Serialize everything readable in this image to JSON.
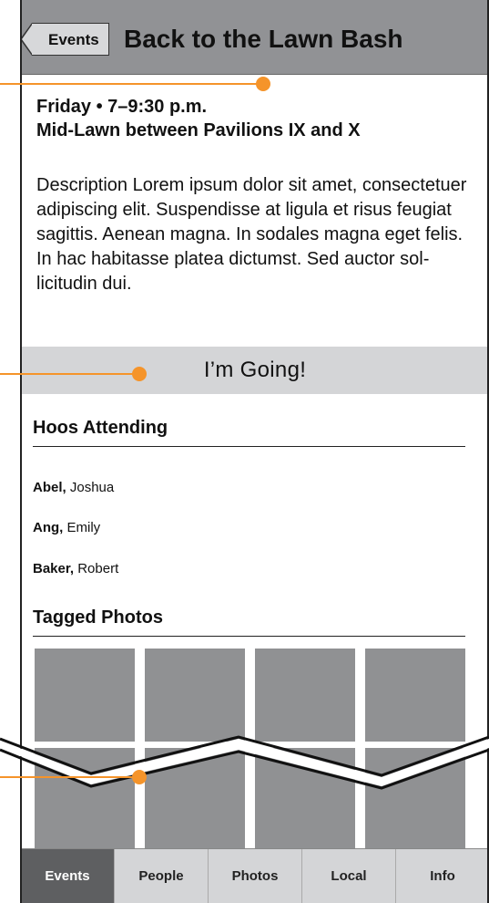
{
  "header": {
    "back_label": "Events",
    "title": "Back to the Lawn Bash"
  },
  "event": {
    "when": "Friday • 7–9:30 p.m.",
    "where": "Mid-Lawn between Pavilions IX and X",
    "description": "Description Lorem ipsum dolor sit amet, consectetuer adipiscing elit. Suspendisse at ligula et risus feugiat sagittis. Aenean magna. In sodales magna eget felis. In hac habitasse platea dictumst. Sed auctor sol-licitudin dui."
  },
  "going_button": "I’m Going!",
  "attending": {
    "heading": "Hoos Attending",
    "people": [
      {
        "last": "Abel,",
        "first": " Joshua"
      },
      {
        "last": "Ang,",
        "first": " Emily"
      },
      {
        "last": "Baker,",
        "first": " Robert"
      }
    ]
  },
  "photos": {
    "heading": "Tagged Photos"
  },
  "tabs": [
    "Events",
    "People",
    "Photos",
    "Local",
    "Info"
  ],
  "colors": {
    "header": "#919295",
    "button": "#d4d5d7",
    "photo": "#909193",
    "annotation": "#f5942a",
    "active_tab": "#5e5f61"
  }
}
